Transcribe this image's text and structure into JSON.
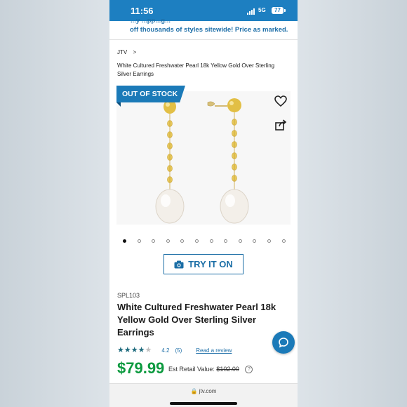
{
  "status_bar": {
    "time": "11:56",
    "network": "5G",
    "battery": "77"
  },
  "promo": {
    "cut_text": "...y ...pp...g...",
    "line": "off thousands of styles sitewide! Price as marked."
  },
  "breadcrumb": {
    "root": "JTV",
    "separator": ">",
    "title": "White Cultured Freshwater Pearl 18k Yellow Gold Over Sterling Silver Earrings"
  },
  "gallery": {
    "badge": "OUT OF STOCK",
    "image_count": 12,
    "active_index": 0
  },
  "try_on": {
    "label": "TRY IT ON"
  },
  "product": {
    "sku": "SPL103",
    "title": "White Cultured Freshwater Pearl 18k Yellow Gold Over Sterling Silver Earrings",
    "rating_stars": 4.2,
    "rating_value": "4.2",
    "rating_count": "(5)",
    "review_link": "Read a review",
    "price": "$79.99",
    "est_label": "Est Retail Value:",
    "est_value": "$102.00",
    "help_glyph": "?"
  },
  "browser": {
    "url": "jtv.com"
  },
  "icons": [
    "heart-icon",
    "share-icon",
    "camera-icon",
    "chat-icon",
    "lock-icon",
    "signal-icon",
    "battery-icon"
  ],
  "colors": {
    "brand_blue": "#1b7ab8",
    "price_green": "#0c9a3f",
    "star": "#1e6b7e"
  }
}
